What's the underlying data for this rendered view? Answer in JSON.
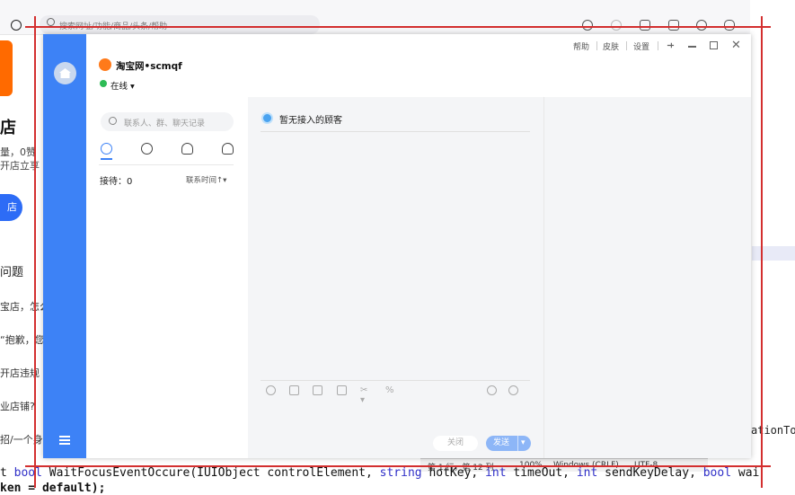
{
  "background": {
    "search_placeholder": "搜索网址/功能/商品/头条/帮助",
    "shop_title": "店",
    "shop_line1": "量，0赞",
    "shop_line2": "开店立享",
    "open_button": "店",
    "faq_title": "问题",
    "faq_items": [
      "宝店，怎么",
      "“抱歉，您",
      "开店违规",
      "业店铺?",
      "招/一个身"
    ],
    "code_right": "ationTo",
    "code_line1_parts": [
      "t ",
      "bool",
      " WaitFocusEventOccure(IUIObject controlElement, ",
      "string",
      " hotKey, ",
      "int",
      " timeOut, ",
      "int",
      " sendKeyDelay, ",
      "bool",
      " wai"
    ],
    "code_line2": "ken = default);",
    "status_bar": {
      "position": "第 1 行，第 12 列",
      "zoom": "100%",
      "line_ending": "Windows (CRLF)",
      "encoding": "UTF-8"
    }
  },
  "window": {
    "header_links": [
      "帮助",
      "皮肤",
      "设置"
    ],
    "store_name": "淘宝网•scmqf",
    "status": "在线",
    "status_caret": "▾",
    "search_placeholder": "联系人、群、聊天记录",
    "reception_label": "接待：0",
    "sort_label": "联系时间↑▾",
    "chat_empty_title": "暂无接入的顾客",
    "close_button": "关闭",
    "send_button": "发送",
    "send_arrow": "▾",
    "close_glyph": "✕"
  },
  "colors": {
    "rail": "#3d82f6",
    "accent": "#3d82f6",
    "online": "#2dbb55",
    "overlay_lines": "#d32f2f"
  }
}
